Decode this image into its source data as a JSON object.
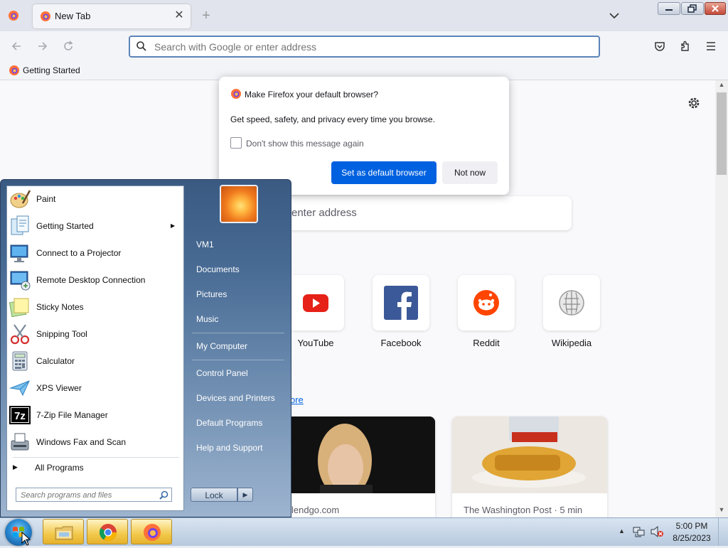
{
  "browser": {
    "tab": {
      "title": "New Tab",
      "close": "✕"
    },
    "new_tab": "+",
    "url_bar": {
      "placeholder": "Search with Google or enter address"
    },
    "bookmarks": [
      {
        "label": "Getting Started"
      }
    ]
  },
  "page": {
    "search_placeholder_visible": "enter address",
    "top_sites": [
      {
        "label": "YouTube",
        "icon": "youtube-icon"
      },
      {
        "label": "Facebook",
        "icon": "facebook-icon"
      },
      {
        "label": "Reddit",
        "icon": "reddit-icon"
      },
      {
        "label": "Wikipedia",
        "icon": "wikipedia-icon"
      }
    ],
    "more_link": "ore",
    "stories": [
      {
        "source": "lendgo.com"
      },
      {
        "source": "The Washington Post · 5 min"
      }
    ]
  },
  "dialog": {
    "title": "Make Firefox your default browser?",
    "body": "Get speed, safety, and privacy every time you browse.",
    "checkbox_label": "Don't show this message again",
    "checkbox_checked": false,
    "primary_button": "Set as default browser",
    "secondary_button": "Not now",
    "primary_color": "#0061e0"
  },
  "start_menu": {
    "programs": [
      {
        "label": "Paint",
        "icon": "paint-icon"
      },
      {
        "label": "Getting Started",
        "icon": "getting-started-icon",
        "has_submenu": true
      },
      {
        "label": "Connect to a Projector",
        "icon": "projector-icon"
      },
      {
        "label": "Remote Desktop Connection",
        "icon": "remote-desktop-icon"
      },
      {
        "label": "Sticky Notes",
        "icon": "sticky-notes-icon"
      },
      {
        "label": "Snipping Tool",
        "icon": "scissors-icon"
      },
      {
        "label": "Calculator",
        "icon": "calculator-icon"
      },
      {
        "label": "XPS Viewer",
        "icon": "xps-viewer-icon"
      },
      {
        "label": "7-Zip File Manager",
        "icon": "7zip-icon",
        "icon_text": "7z"
      },
      {
        "label": "Windows Fax and Scan",
        "icon": "fax-icon"
      }
    ],
    "all_programs": "All Programs",
    "search_placeholder": "Search programs and files",
    "right_items": [
      {
        "label": "VM1"
      },
      {
        "label": "Documents"
      },
      {
        "label": "Pictures"
      },
      {
        "label": "Music"
      },
      {
        "label": "My Computer"
      },
      {
        "label": "Control Panel"
      },
      {
        "label": "Devices and Printers"
      },
      {
        "label": "Default Programs"
      },
      {
        "label": "Help and Support"
      }
    ],
    "lock_button": "Lock",
    "lock_arrow": "▶"
  },
  "taskbar": {
    "apps": [
      {
        "name": "File Explorer",
        "icon": "folder-icon"
      },
      {
        "name": "Google Chrome",
        "icon": "chrome-icon"
      },
      {
        "name": "Firefox",
        "icon": "firefox-icon"
      }
    ],
    "clock": {
      "time": "5:00 PM",
      "date": "8/25/2023"
    }
  }
}
